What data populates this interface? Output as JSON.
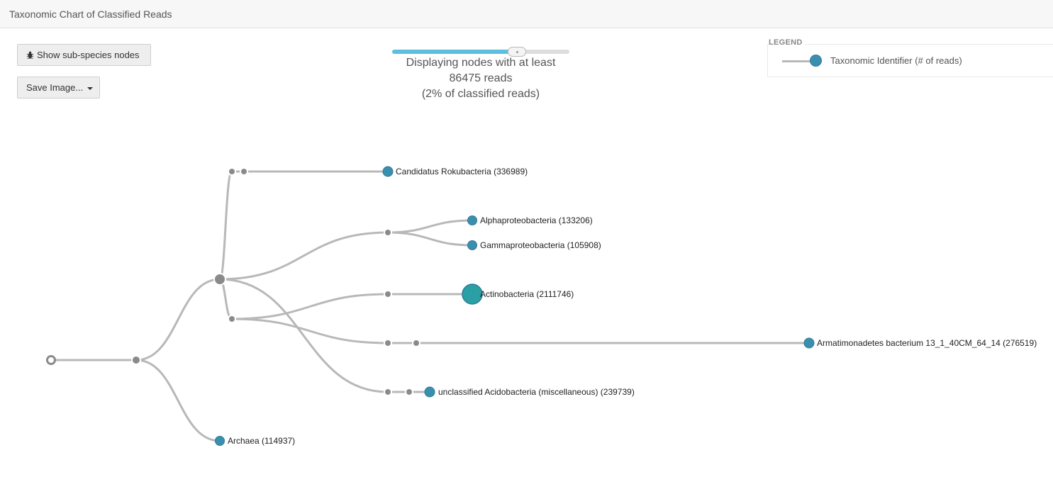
{
  "header": {
    "title": "Taxonomic Chart of Classified Reads"
  },
  "toolbar": {
    "show_subspecies_label": "Show sub-species nodes",
    "save_image_label": "Save Image..."
  },
  "filter": {
    "slider_fraction": 0.75,
    "line1": "Displaying nodes with at least",
    "line2": "86475 reads",
    "line3": "(2% of classified reads)"
  },
  "legend": {
    "title": "LEGEND",
    "label": "Taxonomic Identifier (# of reads)"
  },
  "colors": {
    "node_fill": "#3a8fae",
    "node_large": "#2aa0a4",
    "link": "#b8b8b8",
    "internal_node": "#8a8a8a",
    "slider_fill": "#5bc0de"
  },
  "tree": {
    "nodes": [
      {
        "label": "Candidatus Rokubacteria (336989)"
      },
      {
        "label": "Alphaproteobacteria (133206)"
      },
      {
        "label": "Gammaproteobacteria (105908)"
      },
      {
        "label": "Actinobacteria (2111746)"
      },
      {
        "label": "Armatimonadetes bacterium 13_1_40CM_64_14 (276519)"
      },
      {
        "label": "unclassified Acidobacteria (miscellaneous) (239739)"
      },
      {
        "label": "Archaea (114937)"
      }
    ]
  }
}
